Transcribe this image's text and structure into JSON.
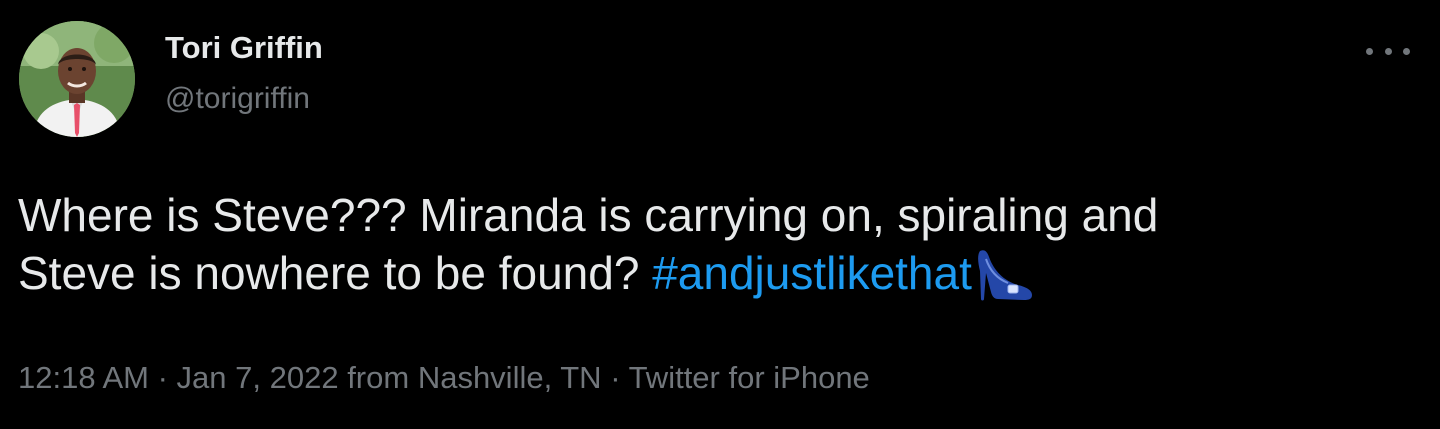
{
  "tweet": {
    "author": {
      "name": "Tori Griffin",
      "handle": "@torigriffin"
    },
    "more_icon": "more-horizontal-icon",
    "text_part1": "Where is Steve??? Miranda is carrying on, spiraling and ",
    "text_part2": "Steve is nowhere to be found? ",
    "hashtag": "#andjustlikethat",
    "emoji_icon": "high-heel-shoe-icon",
    "meta": {
      "time": "12:18 AM",
      "sep1": " · ",
      "date": "Jan 7, 2022",
      "location_prefix": " from ",
      "location": "Nashville, TN",
      "sep2": " · ",
      "source": "Twitter for iPhone"
    }
  },
  "colors": {
    "background": "#000000",
    "text": "#e7e9ea",
    "secondary": "#71767b",
    "link": "#1d9bf0",
    "heel": "#2447a8"
  }
}
